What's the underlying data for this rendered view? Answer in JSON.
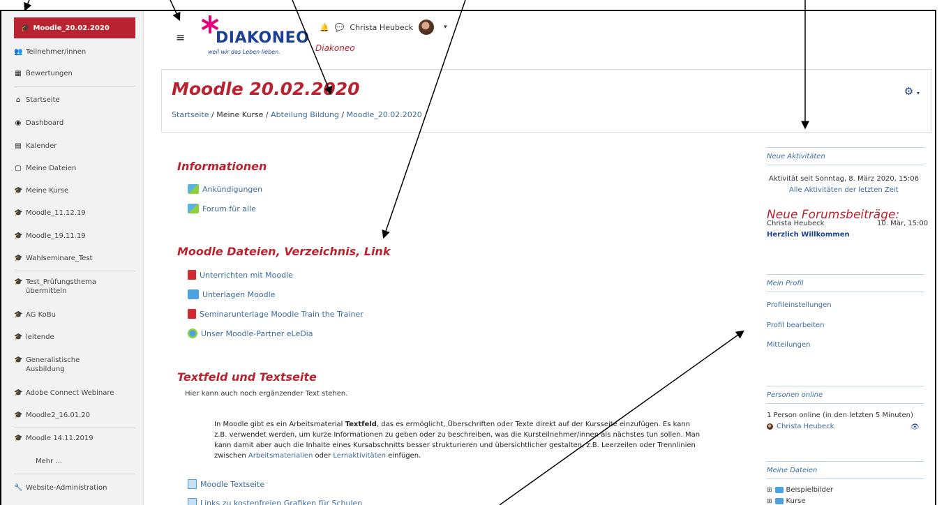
{
  "sidebar": {
    "active_course": "Moodle_20.02.2020",
    "items": [
      {
        "label": "Teilnehmer/innen",
        "icon": "users-icon"
      },
      {
        "label": "Bewertungen",
        "icon": "table-icon"
      },
      {
        "label": "Startseite",
        "icon": "home-icon"
      },
      {
        "label": "Dashboard",
        "icon": "dashboard-icon"
      },
      {
        "label": "Kalender",
        "icon": "calendar-icon"
      },
      {
        "label": "Meine Dateien",
        "icon": "file-icon"
      },
      {
        "label": "Meine Kurse",
        "icon": "graduation-cap-icon"
      },
      {
        "label": "Moodle_11.12.19",
        "icon": "graduation-cap-icon"
      },
      {
        "label": "Moodle_19.11.19",
        "icon": "graduation-cap-icon"
      },
      {
        "label": "Wahlseminare_Test",
        "icon": "graduation-cap-icon"
      },
      {
        "label": "Test_Prüfungsthema übermitteln",
        "icon": "graduation-cap-icon"
      },
      {
        "label": "AG KoBu",
        "icon": "graduation-cap-icon"
      },
      {
        "label": "leitende",
        "icon": "graduation-cap-icon"
      },
      {
        "label": "Generalistische Ausbildung",
        "icon": "graduation-cap-icon"
      },
      {
        "label": "Adobe Connect Webinare",
        "icon": "graduation-cap-icon"
      },
      {
        "label": "Moodle2_16.01.20",
        "icon": "graduation-cap-icon"
      },
      {
        "label": "Moodle 14.11.2019",
        "icon": "graduation-cap-icon"
      },
      {
        "label": "Mehr ...",
        "icon": ""
      },
      {
        "label": "Website-Administration",
        "icon": "wrench-icon"
      }
    ]
  },
  "header": {
    "logo_text": "DIAKONEO",
    "logo_tagline": "weil wir das Leben lieben.",
    "site_name": "Diakoneo",
    "user_name": "Christa Heubeck"
  },
  "page": {
    "title": "Moodle 20.02.2020",
    "breadcrumb": [
      "Startseite",
      "Meine Kurse",
      "Abteilung Bildung",
      "Moodle_20.02.2020"
    ]
  },
  "sections": {
    "informationen": {
      "title": "Informationen",
      "activities": [
        "Ankündigungen",
        "Forum für alle"
      ]
    },
    "dateien": {
      "title": "Moodle Dateien, Verzeichnis, Link",
      "activities": [
        "Unterrichten mit Moodle",
        "Unterlagen Moodle",
        "Seminarunterlage Moodle Train the Trainer",
        "Unser Moodle-Partner eLeDia"
      ]
    },
    "textfeld": {
      "title": "Textfeld und Textseite",
      "intro": "Hier kann auch noch ergänzender Text stehen.",
      "para_1": "In Moodle gibt es ein Arbeitsmaterial ",
      "para_bold": "Textfeld",
      "para_2": ", das es ermöglicht, Überschriften oder Texte direkt auf der Kursseite einzufügen. Es kann z.B. verwendet werden, um kurze Informationen zu geben oder zu beschreiben, was die Kursteilnehmer/innen als nächstes tun sollen. Man kann damit aber auch die Inhalte eines Kursabschnitts besser strukturieren und übersichtlicher gestalten, z.B. Leerzeilen oder Trennlinien zwischen ",
      "link_1": "Arbeitsmaterialien",
      "para_3": " oder ",
      "link_2": "Lernaktivitäten",
      "para_4": " einfügen.",
      "activities": [
        "Moodle Textseite",
        "Links zu kostenfreien Grafiken für Schulen"
      ]
    }
  },
  "blocks": {
    "recent": {
      "title": "Neue Aktivitäten",
      "since": "Aktivität seit Sonntag, 8. März 2020, 15:06",
      "all_link": "Alle Aktivitäten der letzten Zeit",
      "forum_heading": "Neue Forumsbeiträge:",
      "post_author": "Christa Heubeck",
      "post_date": "10. Mär, 15:00",
      "post_title": "Herzlich Willkommen"
    },
    "profile": {
      "title": "Mein Profil",
      "links": [
        "Profileinstellungen",
        "Profil bearbeiten",
        "Mitteilungen"
      ]
    },
    "online": {
      "title": "Personen online",
      "summary": "1 Person online (in den letzten 5 Minuten)",
      "user": "Christa Heubeck"
    },
    "files": {
      "title": "Meine Dateien",
      "items": [
        "Beispielbilder",
        "Kurse"
      ]
    }
  },
  "colors": {
    "accent": "#b9232f",
    "link": "#3a6b9e",
    "brand_blue": "#1c3f93"
  }
}
